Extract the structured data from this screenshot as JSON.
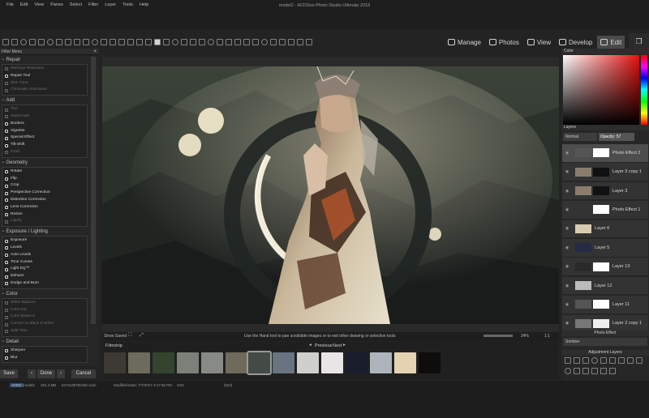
{
  "app": {
    "title": "model2 - ACDSee Photo Studio Ultimate 2018"
  },
  "menu": [
    "File",
    "Edit",
    "View",
    "Panes",
    "Select",
    "Filter",
    "Layer",
    "Tools",
    "Help"
  ],
  "modes": [
    {
      "label": "Manage",
      "icon": "grid-icon",
      "active": false
    },
    {
      "label": "Photos",
      "icon": "photos-icon",
      "active": false
    },
    {
      "label": "View",
      "icon": "eye-icon",
      "active": false
    },
    {
      "label": "Develop",
      "icon": "develop-icon",
      "active": false
    },
    {
      "label": "Edit",
      "icon": "edit-icon",
      "active": true
    }
  ],
  "left_panel": {
    "title": "Filter Menu",
    "sections": [
      {
        "title": "Repair",
        "tools": [
          {
            "label": "Red Eye Reduction",
            "dim": true
          },
          {
            "label": "Repair Tool",
            "dim": false
          },
          {
            "label": "Skin Tune",
            "dim": true
          },
          {
            "label": "Chromatic Aberration",
            "dim": true
          }
        ]
      },
      {
        "title": "Add",
        "tools": [
          {
            "label": "Text",
            "dim": true
          },
          {
            "label": "Watermark",
            "dim": true
          },
          {
            "label": "Borders",
            "dim": false
          },
          {
            "label": "Vignette",
            "dim": false
          },
          {
            "label": "Special Effect",
            "dim": false
          },
          {
            "label": "Tilt-Shift",
            "dim": false
          },
          {
            "label": "Grain",
            "dim": true
          }
        ]
      },
      {
        "title": "Geometry",
        "tools": [
          {
            "label": "Rotate",
            "dim": false
          },
          {
            "label": "Flip",
            "dim": false
          },
          {
            "label": "Crop",
            "dim": false
          },
          {
            "label": "Perspective Correction",
            "dim": false
          },
          {
            "label": "Distortion Correction",
            "dim": false
          },
          {
            "label": "Lens Correction",
            "dim": false
          },
          {
            "label": "Resize",
            "dim": false
          },
          {
            "label": "Liquify",
            "dim": true
          }
        ]
      },
      {
        "title": "Exposure / Lighting",
        "tools": [
          {
            "label": "Exposure",
            "dim": false
          },
          {
            "label": "Levels",
            "dim": false
          },
          {
            "label": "Auto Levels",
            "dim": false
          },
          {
            "label": "Tone Curves",
            "dim": false
          },
          {
            "label": "Light EQ™",
            "dim": false
          },
          {
            "label": "Dehaze",
            "dim": false
          },
          {
            "label": "Dodge and Burn",
            "dim": false
          }
        ]
      },
      {
        "title": "Color",
        "tools": [
          {
            "label": "White Balance",
            "dim": true
          },
          {
            "label": "Color EQ",
            "dim": true
          },
          {
            "label": "Color Balance",
            "dim": true
          },
          {
            "label": "Convert to Black & White",
            "dim": true
          },
          {
            "label": "Split Tone",
            "dim": true
          }
        ]
      },
      {
        "title": "Detail",
        "tools": [
          {
            "label": "Sharpen",
            "dim": false
          },
          {
            "label": "Blur",
            "dim": false
          }
        ]
      }
    ],
    "buttons": {
      "save": "Save",
      "done": "Done",
      "cancel": "Cancel"
    }
  },
  "canvas": {
    "show_saved": "Show Saved",
    "hint": "Use the Hand tool to pan scrollable images or to exit other drawing or selection tools",
    "zoom": "24%",
    "ratio": "1:1"
  },
  "filmstrip": {
    "title": "Filmstrip",
    "previous": "Previous",
    "next": "Next"
  },
  "status": {
    "file": "model2",
    "size": "291.4 MB",
    "dims": "5472x3078x32b acdc",
    "modified": "Modified Date: 7/7/2017 3:17:56 PM",
    "zoom": "24%",
    "coords": "(0x0)",
    "format": "ACDC"
  },
  "right_panel": {
    "color_title": "Color",
    "layers_title": "Layers",
    "blend": "Normal",
    "opacity": "Opacity: 57",
    "layers": [
      {
        "name": "Photo Effect 2",
        "selected": true
      },
      {
        "name": "Layer 3 copy 1",
        "selected": false
      },
      {
        "name": "Layer 3",
        "selected": false
      },
      {
        "name": "Photo Effect 1",
        "selected": false
      },
      {
        "name": "Layer 6",
        "selected": false
      },
      {
        "name": "Layer 5",
        "selected": false
      },
      {
        "name": "Layer 13",
        "selected": false
      },
      {
        "name": "Layer 12",
        "selected": false
      },
      {
        "name": "Layer 11",
        "selected": false
      },
      {
        "name": "Layer 2 copy 1",
        "selected": false
      }
    ],
    "photo_effect_title": "Photo Effect",
    "photo_effect_value": "Somber",
    "adjustment_title": "Adjustment Layers"
  }
}
